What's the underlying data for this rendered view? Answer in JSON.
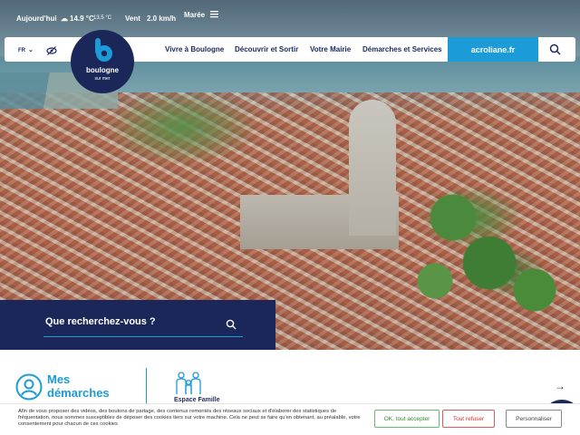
{
  "weather": {
    "today_label": "Aujourd'hui",
    "temp": "14.9 °C",
    "temp_min": "13.5 °C",
    "wind_label": "Vent",
    "wind_value": "2.0 km/h",
    "tide_label": "Marée"
  },
  "nav": {
    "lang": "FR",
    "items": [
      "Vivre à Boulogne",
      "Découvrir et Sortir",
      "Votre Mairie",
      "Démarches et Services"
    ],
    "acroliane": "acroliane.fr"
  },
  "logo": {
    "word": "boulogne",
    "sub": "sur mer"
  },
  "search": {
    "label": "Que recherchez-vous ?"
  },
  "demarches": {
    "title_line1": "Mes",
    "title_line2": "démarches",
    "famille_label": "Espace Famille"
  },
  "cookie": {
    "text": "Afin de vous proposer des vidéos, des boutons de partage, des contenus remontés des réseaux sociaux et d'élaborer des statistiques de fréquentation, nous sommes susceptibles de déposer des cookies tiers sur votre machine. Cela ne peut se faire qu'en obtenant, au préalable, votre consentement pour chacun de ces cookies",
    "accept": "OK, tout accepter",
    "refuse": "Tout refuser",
    "customize": "Personnaliser"
  },
  "colors": {
    "navy": "#1a2758",
    "accent": "#1b9bd8"
  }
}
